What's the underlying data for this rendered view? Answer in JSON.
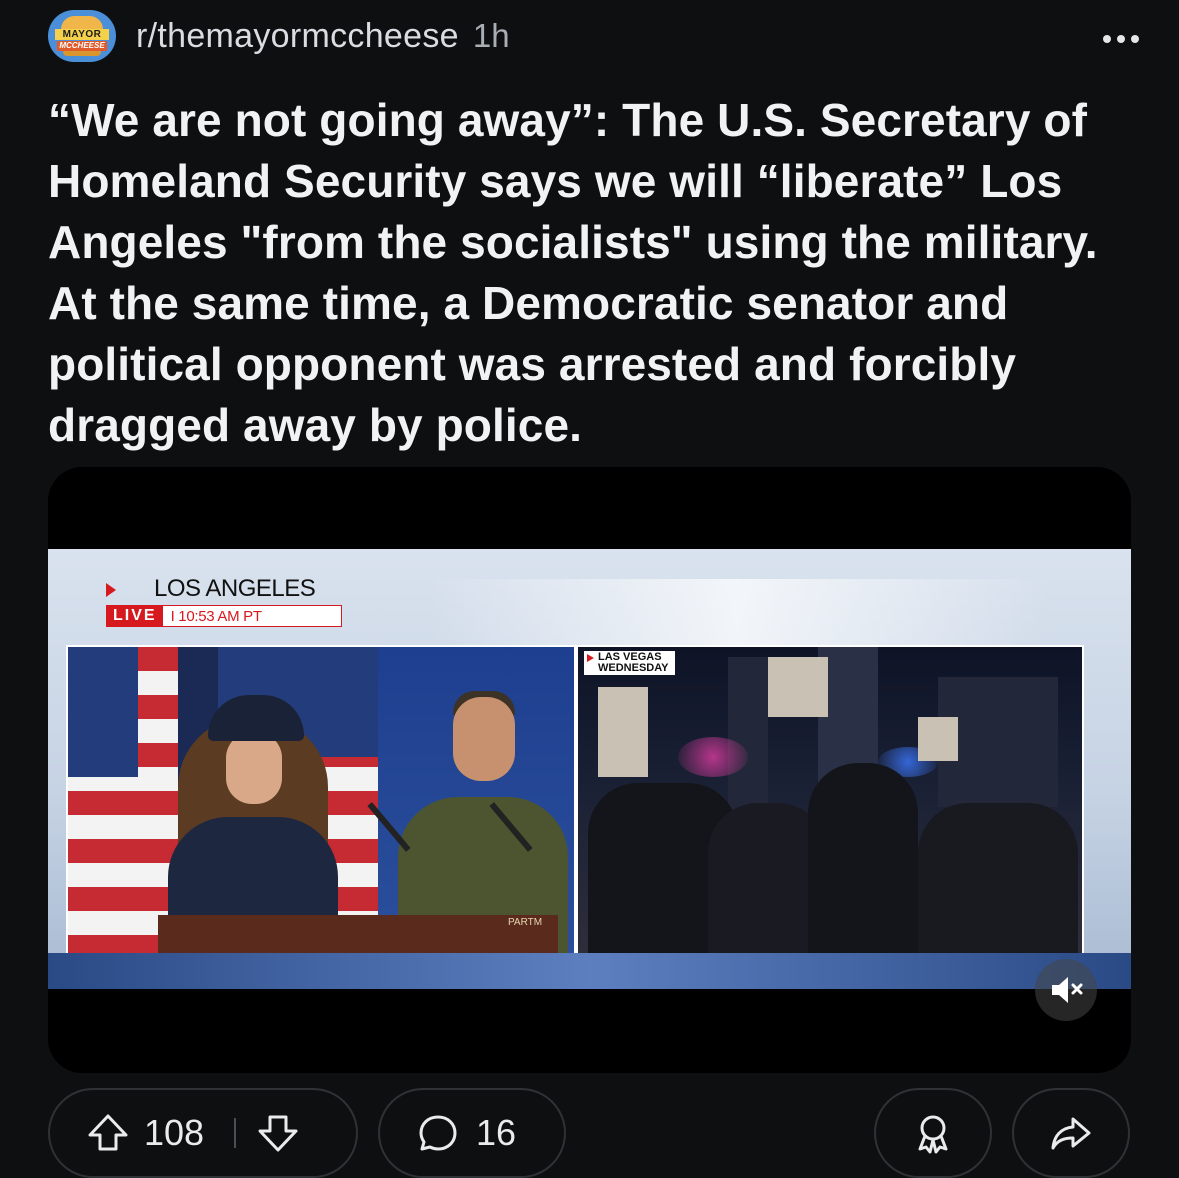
{
  "post": {
    "subreddit": "r/themayormccheese",
    "age": "1h",
    "avatar_text_top": "MAYOR",
    "avatar_text_bottom": "MCCHEESE",
    "title": "“We are not going away”: The U.S. Secretary of Homeland Security says we will “liberate” Los Angeles \"from the socialists\" using the military. At the same time, a Democratic senator and political opponent was arrested and forcibly dragged away by police."
  },
  "video": {
    "location": "LOS ANGELES",
    "live_label": "LIVE",
    "live_time": "I  10:53 AM PT",
    "inset_tag_line1": "LAS VEGAS",
    "inset_tag_line2": "WEDNESDAY",
    "podium_text": "PARTM",
    "muted": true
  },
  "actions": {
    "upvotes": "108",
    "comments": "16"
  },
  "colors": {
    "background": "#0e0f10",
    "text": "#f1f2f4",
    "meta": "#a8aeb4",
    "pill_border": "#2f3234",
    "accent_red": "#d6191f"
  },
  "icons": [
    "more-icon",
    "mute-icon",
    "upvote-icon",
    "downvote-icon",
    "comment-icon",
    "award-icon",
    "share-icon"
  ]
}
